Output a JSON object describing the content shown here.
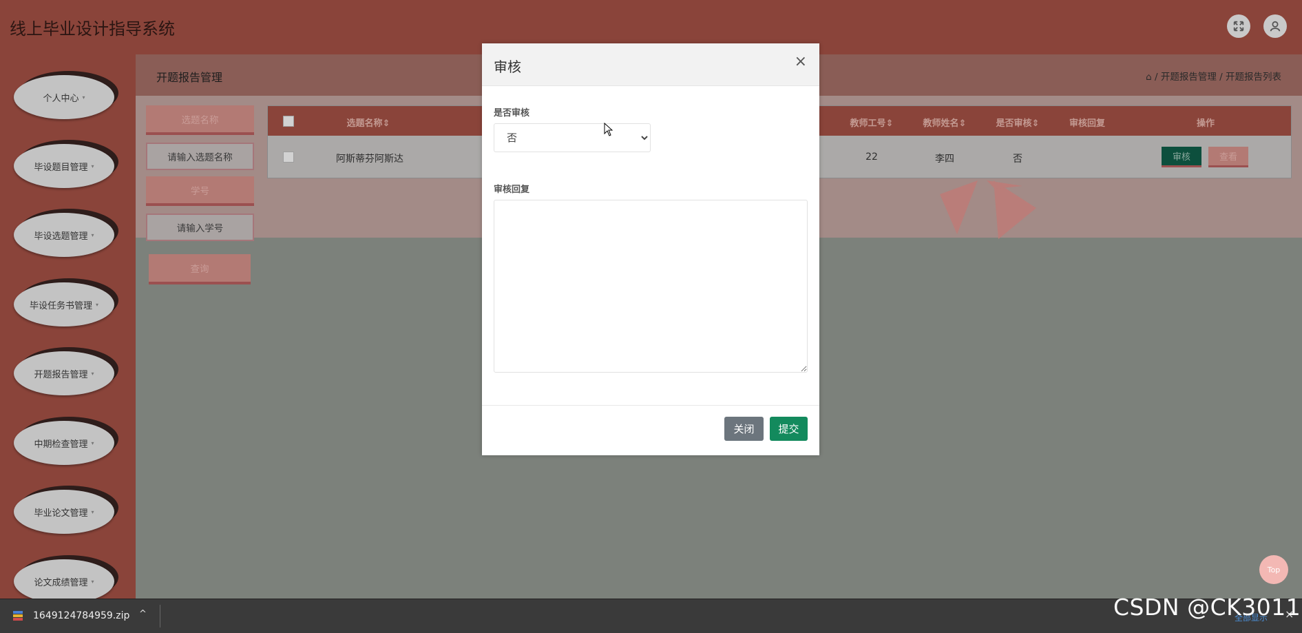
{
  "app": {
    "title": "线上毕业设计指导系统",
    "icons": {
      "fullscreen": "fullscreen-icon",
      "user": "user-icon"
    }
  },
  "sidebar": {
    "items": [
      {
        "label": "个人中心"
      },
      {
        "label": "毕设题目管理"
      },
      {
        "label": "毕设选题管理"
      },
      {
        "label": "毕设任务书管理"
      },
      {
        "label": "开题报告管理"
      },
      {
        "label": "中期检查管理"
      },
      {
        "label": "毕业论文管理"
      },
      {
        "label": "论文成绩管理"
      }
    ],
    "caret": "▾"
  },
  "header": {
    "section_title": "开题报告管理",
    "breadcrumb": "/ 开题报告管理 / 开题报告列表"
  },
  "filters": {
    "topic_label": "选题名称",
    "topic_placeholder": "请输入选题名称",
    "student_label": "学号",
    "student_placeholder": "请输入学号",
    "query_label": "查询"
  },
  "table": {
    "columns": [
      "选题名称",
      "教师工号",
      "教师姓名",
      "是否审核",
      "审核回复",
      "操作"
    ],
    "rows": [
      {
        "topic": "阿斯蒂芬阿斯达",
        "teacher_no": "22",
        "teacher_name": "李四",
        "audited": "否",
        "reply": ""
      }
    ],
    "audit_label": "审核",
    "view_label": "查看"
  },
  "modal": {
    "title": "审核",
    "close_glyph": "×",
    "audit_field_label": "是否审核",
    "audit_value": "否",
    "audit_options": [
      "否"
    ],
    "reply_field_label": "审核回复",
    "reply_value": "",
    "close_button": "关闭",
    "submit_button": "提交"
  },
  "top_button": "Top",
  "download_bar": {
    "filename": "1649124784959.zip",
    "chevron": "^",
    "show_all": "全部显示",
    "close_glyph": "×"
  },
  "watermark": "CSDN @CK3011",
  "colors": {
    "header_bg": "#8a443a",
    "modal_header_bg": "#f2f2f2",
    "submit": "#138a5d",
    "close_button": "#6c757d"
  }
}
